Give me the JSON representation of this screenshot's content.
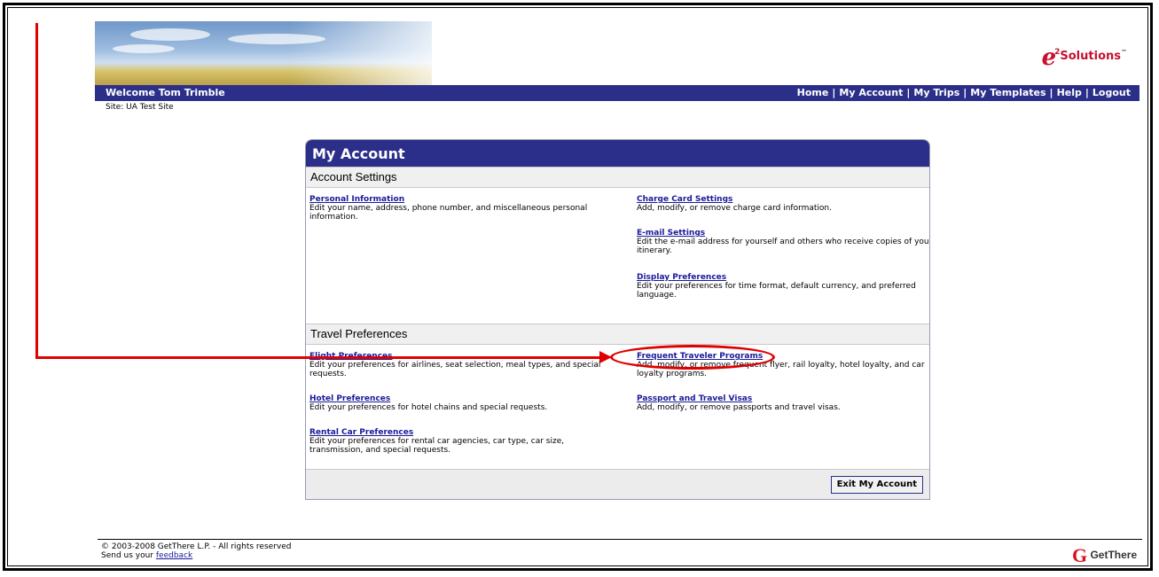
{
  "header": {
    "welcome": "Welcome Tom Trimble",
    "site": "Site: UA Test Site",
    "logo_text": "Solutions",
    "nav": [
      "Home",
      "My Account",
      "My Trips",
      "My Templates",
      "Help",
      "Logout"
    ]
  },
  "panel": {
    "title": "My Account",
    "account_settings": {
      "title": "Account Settings",
      "items": [
        {
          "title": "Personal Information",
          "desc": "Edit your name, address, phone number, and miscellaneous personal information."
        },
        {
          "title": "Charge Card Settings",
          "desc": "Add, modify, or remove charge card information."
        },
        {
          "title": "E-mail Settings",
          "desc": "Edit the e-mail address for yourself and others who receive copies of your itinerary."
        },
        {
          "title": "Display Preferences",
          "desc": "Edit your preferences for time format, default currency, and preferred language."
        }
      ]
    },
    "travel_preferences": {
      "title": "Travel Preferences",
      "items": [
        {
          "title": "Flight Preferences",
          "desc": "Edit your preferences for airlines, seat selection, meal types, and special requests."
        },
        {
          "title": "Frequent Traveler Programs",
          "desc": "Add, modify, or remove frequent flyer, rail loyalty, hotel loyalty, and car loyalty programs."
        },
        {
          "title": "Hotel Preferences",
          "desc": "Edit your preferences for hotel chains and special requests."
        },
        {
          "title": "Passport and Travel Visas",
          "desc": "Add, modify, or remove passports and travel visas."
        },
        {
          "title": "Rental Car Preferences",
          "desc": "Edit your preferences for rental car agencies, car type, car size, transmission, and special requests."
        }
      ]
    },
    "exit_button": "Exit My Account"
  },
  "footer": {
    "copyright": "© 2003-2008 GetThere L.P. - All rights reserved",
    "feedback_prefix": "Send us your ",
    "feedback_link": "feedback",
    "logo_text": "GetThere"
  },
  "colors": {
    "nav_blue": "#2b2f8a",
    "link_blue": "#1a1a9a",
    "annotation_red": "#e00000"
  }
}
